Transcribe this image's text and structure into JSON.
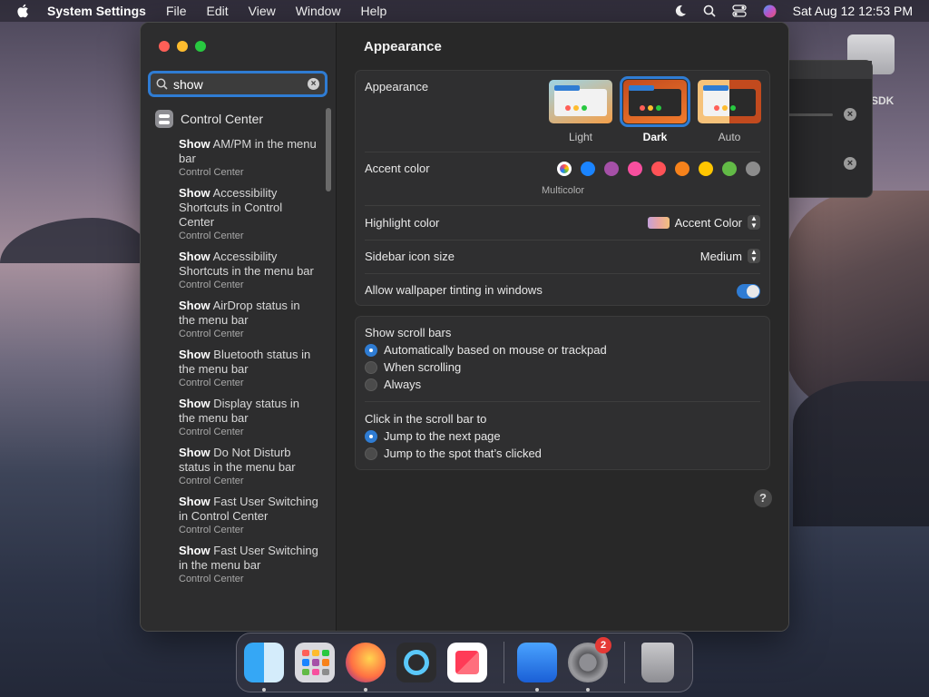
{
  "menubar": {
    "app_name": "System Settings",
    "menus": [
      "File",
      "Edit",
      "View",
      "Window",
      "Help"
    ],
    "datetime": "Sat Aug 12  12:53 PM"
  },
  "desktop": {
    "drive_label": "SDK"
  },
  "sidebar": {
    "search_value": "show",
    "group": "Control Center",
    "results": [
      {
        "match": "Show",
        "rest": " AM/PM in the menu bar",
        "source": "Control Center"
      },
      {
        "match": "Show",
        "rest": " Accessibility Shortcuts in Control Center",
        "source": "Control Center"
      },
      {
        "match": "Show",
        "rest": " Accessibility Shortcuts in the menu bar",
        "source": "Control Center"
      },
      {
        "match": "Show",
        "rest": " AirDrop status in the menu bar",
        "source": "Control Center"
      },
      {
        "match": "Show",
        "rest": " Bluetooth status in the menu bar",
        "source": "Control Center"
      },
      {
        "match": "Show",
        "rest": " Display status in the menu bar",
        "source": "Control Center"
      },
      {
        "match": "Show",
        "rest": " Do Not Disturb status in the menu bar",
        "source": "Control Center"
      },
      {
        "match": "Show",
        "rest": " Fast User Switching in Control Center",
        "source": "Control Center"
      },
      {
        "match": "Show",
        "rest": " Fast User Switching in the menu bar",
        "source": "Control Center"
      }
    ]
  },
  "content": {
    "title": "Appearance",
    "appearance_label": "Appearance",
    "modes": [
      {
        "label": "Light",
        "selected": false
      },
      {
        "label": "Dark",
        "selected": true
      },
      {
        "label": "Auto",
        "selected": false
      }
    ],
    "accent_label": "Accent color",
    "accent_colors": [
      "#multicolor",
      "#1a84ff",
      "#a550a7",
      "#f74f9e",
      "#ff5257",
      "#f7821b",
      "#ffc600",
      "#62ba46",
      "#8c8c8c"
    ],
    "accent_selected_name": "Multicolor",
    "highlight_label": "Highlight color",
    "highlight_value": "Accent Color",
    "sidebar_icon_label": "Sidebar icon size",
    "sidebar_icon_value": "Medium",
    "tinting_label": "Allow wallpaper tinting in windows",
    "tinting_on": true,
    "scrollbars_label": "Show scroll bars",
    "scrollbar_options": [
      {
        "label": "Automatically based on mouse or trackpad",
        "selected": true
      },
      {
        "label": "When scrolling",
        "selected": false
      },
      {
        "label": "Always",
        "selected": false
      }
    ],
    "click_label": "Click in the scroll bar to",
    "click_options": [
      {
        "label": "Jump to the next page",
        "selected": true
      },
      {
        "label": "Jump to the spot that’s clicked",
        "selected": false
      }
    ],
    "help": "?"
  },
  "dock": {
    "apps": [
      "Finder",
      "Launchpad",
      "Firefox",
      "QuickTime Player",
      "News",
      "Xcode",
      "System Settings",
      "Trash"
    ],
    "settings_badge": "2"
  },
  "colors": {
    "accent": "#2f7cd3",
    "window_bg": "#282828",
    "sidebar_bg": "#2d2d2e"
  }
}
